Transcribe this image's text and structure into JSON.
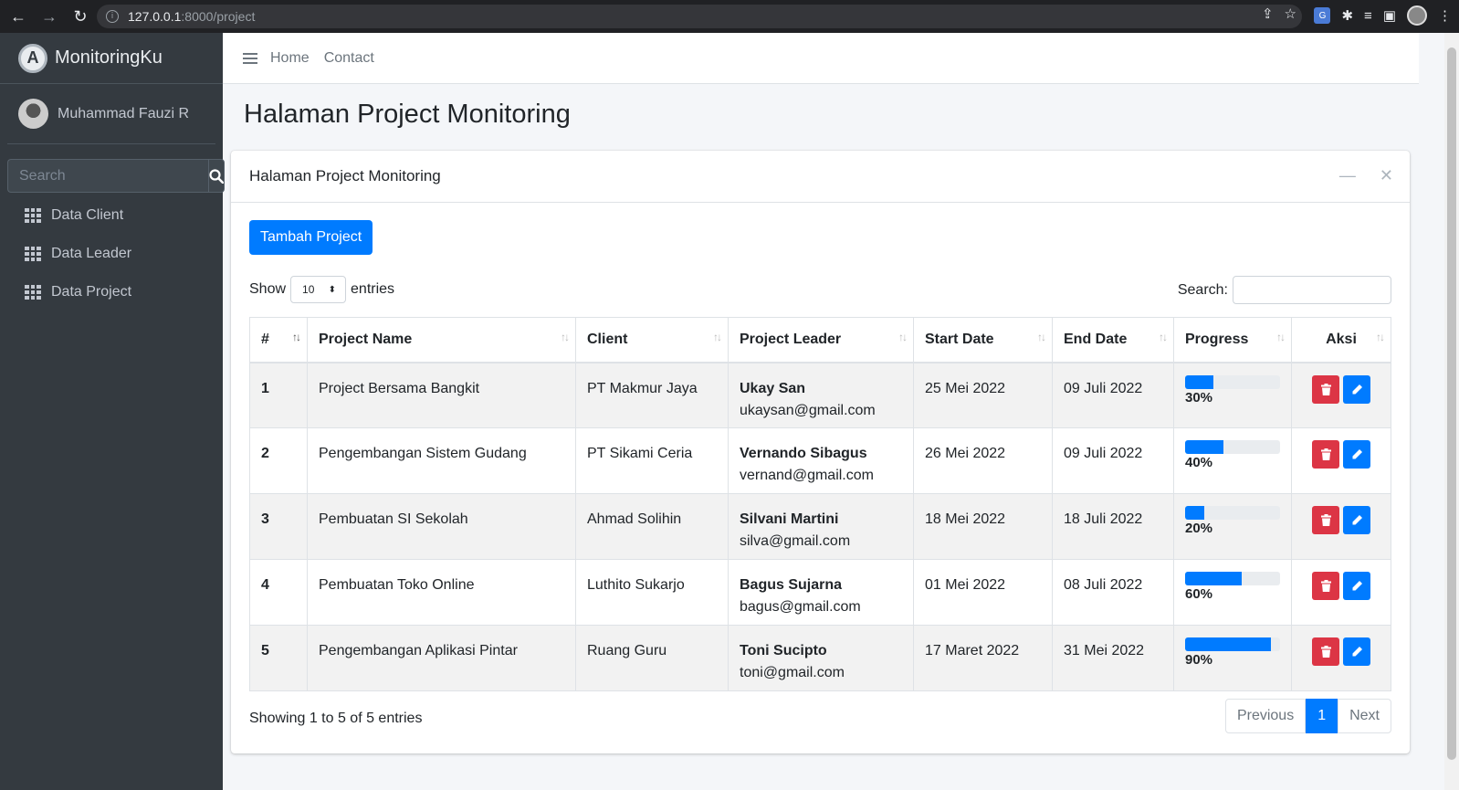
{
  "browser": {
    "url_host": "127.0.0.1",
    "url_path": ":8000/project"
  },
  "sidebar": {
    "brand": "MonitoringKu",
    "user_name": "Muhammad Fauzi R",
    "search_placeholder": "Search",
    "items": [
      {
        "label": "Data Client",
        "icon": "th-icon"
      },
      {
        "label": "Data Leader",
        "icon": "th-icon"
      },
      {
        "label": "Data Project",
        "icon": "th-icon"
      }
    ]
  },
  "topnav": {
    "links": [
      "Home",
      "Contact"
    ]
  },
  "page": {
    "title": "Halaman Project Monitoring"
  },
  "card": {
    "title": "Halaman Project Monitoring",
    "add_button": "Tambah Project",
    "show_label": "Show",
    "entries_label": "entries",
    "page_length": "10",
    "search_label": "Search:"
  },
  "table": {
    "columns": [
      "#",
      "Project Name",
      "Client",
      "Project Leader",
      "Start Date",
      "End Date",
      "Progress",
      "Aksi"
    ],
    "rows": [
      {
        "no": "1",
        "project": "Project Bersama Bangkit",
        "client": "PT Makmur Jaya",
        "leader": "Ukay San",
        "email": "ukaysan@gmail.com",
        "start": "25 Mei 2022",
        "end": "09 Juli 2022",
        "progress": 30,
        "progress_label": "30%"
      },
      {
        "no": "2",
        "project": "Pengembangan Sistem Gudang",
        "client": "PT Sikami Ceria",
        "leader": "Vernando Sibagus",
        "email": "vernand@gmail.com",
        "start": "26 Mei 2022",
        "end": "09 Juli 2022",
        "progress": 40,
        "progress_label": "40%"
      },
      {
        "no": "3",
        "project": "Pembuatan SI Sekolah",
        "client": "Ahmad Solihin",
        "leader": "Silvani Martini",
        "email": "silva@gmail.com",
        "start": "18 Mei 2022",
        "end": "18 Juli 2022",
        "progress": 20,
        "progress_label": "20%"
      },
      {
        "no": "4",
        "project": "Pembuatan Toko Online",
        "client": "Luthito Sukarjo",
        "leader": "Bagus Sujarna",
        "email": "bagus@gmail.com",
        "start": "01 Mei 2022",
        "end": "08 Juli 2022",
        "progress": 60,
        "progress_label": "60%"
      },
      {
        "no": "5",
        "project": "Pengembangan Aplikasi Pintar",
        "client": "Ruang Guru",
        "leader": "Toni Sucipto",
        "email": "toni@gmail.com",
        "start": "17 Maret 2022",
        "end": "31 Mei 2022",
        "progress": 90,
        "progress_label": "90%"
      }
    ]
  },
  "footer": {
    "info": "Showing 1 to 5 of 5 entries",
    "previous": "Previous",
    "current_page": "1",
    "next": "Next"
  },
  "colors": {
    "primary": "#007bff",
    "danger": "#dc3545",
    "sidebar": "#343a40"
  }
}
